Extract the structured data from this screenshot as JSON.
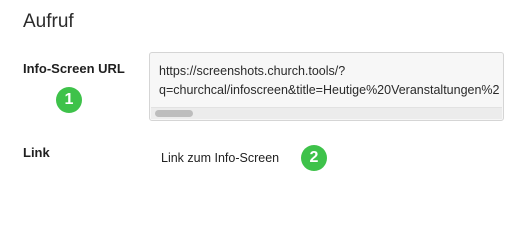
{
  "section": {
    "title": "Aufruf"
  },
  "fields": {
    "url_label": "Info-Screen URL",
    "url_value_line1": "https://screenshots.church.tools/?",
    "url_value_line2": "q=churchcal/infoscreen&title=Heutige%20Veranstaltungen%2",
    "link_label": "Link",
    "link_text": "Link zum Info-Screen"
  },
  "badges": {
    "one": "1",
    "two": "2"
  },
  "colors": {
    "badge": "#3ec24a",
    "field_background": "#f7f7f7",
    "field_border": "#d5d5d5"
  }
}
